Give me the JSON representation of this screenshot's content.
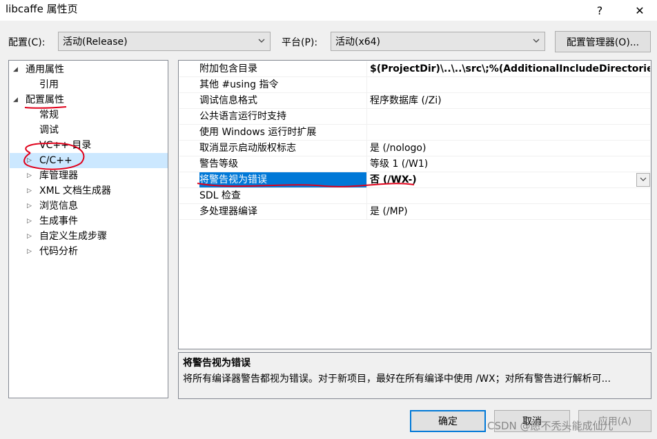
{
  "window": {
    "title": "libcaffe 属性页",
    "help_glyph": "?",
    "close_glyph": "✕"
  },
  "toolbar": {
    "config_label": "配置(C):",
    "config_value": "活动(Release)",
    "platform_label": "平台(P):",
    "platform_value": "活动(x64)",
    "config_manager_label": "配置管理器(O)..."
  },
  "tree": {
    "items": [
      {
        "label": "通用属性",
        "expander": "◢",
        "level": 0
      },
      {
        "label": "引用",
        "expander": "",
        "level": 1
      },
      {
        "label": "配置属性",
        "expander": "◢",
        "level": 0
      },
      {
        "label": "常规",
        "expander": "",
        "level": 1
      },
      {
        "label": "调试",
        "expander": "",
        "level": 1
      },
      {
        "label": "VC++ 目录",
        "expander": "",
        "level": 1
      },
      {
        "label": "C/C++",
        "expander": "▷",
        "level": 1,
        "selected": true
      },
      {
        "label": "库管理器",
        "expander": "▷",
        "level": 1
      },
      {
        "label": "XML 文档生成器",
        "expander": "▷",
        "level": 1
      },
      {
        "label": "浏览信息",
        "expander": "▷",
        "level": 1
      },
      {
        "label": "生成事件",
        "expander": "▷",
        "level": 1
      },
      {
        "label": "自定义生成步骤",
        "expander": "▷",
        "level": 1
      },
      {
        "label": "代码分析",
        "expander": "▷",
        "level": 1
      }
    ]
  },
  "grid": {
    "rows": [
      {
        "name": "附加包含目录",
        "value": "$(ProjectDir)\\..\\..\\src\\;%(AdditionalIncludeDirectories)",
        "bold": true
      },
      {
        "name": "其他 #using 指令",
        "value": "",
        "bold": false
      },
      {
        "name": "调试信息格式",
        "value": "程序数据库 (/Zi)",
        "bold": false
      },
      {
        "name": "公共语言运行时支持",
        "value": "",
        "bold": false
      },
      {
        "name": "使用 Windows 运行时扩展",
        "value": "",
        "bold": false
      },
      {
        "name": "取消显示启动版权标志",
        "value": "是 (/nologo)",
        "bold": false
      },
      {
        "name": "警告等级",
        "value": "等级 1 (/W1)",
        "bold": false
      },
      {
        "name": "将警告视为错误",
        "value": "否 (/WX-)",
        "bold": true,
        "active": true
      },
      {
        "name": "SDL 检查",
        "value": "",
        "bold": false
      },
      {
        "name": "多处理器编译",
        "value": "是 (/MP)",
        "bold": false
      }
    ],
    "dropdown_glyph": "⌵"
  },
  "description": {
    "title": "将警告视为错误",
    "text": "将所有编译器警告都视为错误。对于新项目，最好在所有编译中使用 /WX；对所有警告进行解析可..."
  },
  "footer": {
    "ok_label": "确定",
    "cancel_label": "取消",
    "apply_label": "应用(A)",
    "watermark": "CSDN @愿不秃头能成仙儿"
  },
  "colors": {
    "accent": "#0078d7",
    "selection": "#cce8ff",
    "annotation": "#e0001a"
  }
}
